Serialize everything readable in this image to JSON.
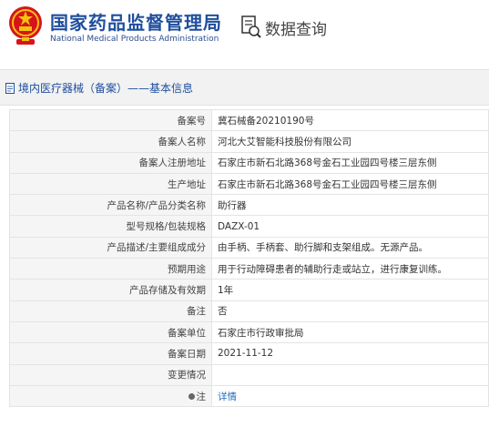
{
  "header": {
    "org_name_cn": "国家药品监督管理局",
    "org_name_en": "National Medical Products Administration",
    "page_title": "数据查询"
  },
  "breadcrumb": {
    "text": "境内医疗器械（备案）——基本信息"
  },
  "table": {
    "rows": [
      {
        "label": "备案号",
        "value": "冀石械备20210190号"
      },
      {
        "label": "备案人名称",
        "value": "河北大艾智能科技股份有限公司"
      },
      {
        "label": "备案人注册地址",
        "value": "石家庄市新石北路368号金石工业园四号楼三层东侧"
      },
      {
        "label": "生产地址",
        "value": "石家庄市新石北路368号金石工业园四号楼三层东侧"
      },
      {
        "label": "产品名称/产品分类名称",
        "value": "助行器"
      },
      {
        "label": "型号规格/包装规格",
        "value": "DAZX-01"
      },
      {
        "label": "产品描述/主要组成成分",
        "value": "由手柄、手柄套、助行脚和支架组成。无源产品。"
      },
      {
        "label": "预期用途",
        "value": "用于行动障碍患者的辅助行走或站立，进行康复训练。"
      },
      {
        "label": "产品存储及有效期",
        "value": "1年"
      },
      {
        "label": "备注",
        "value": "否"
      },
      {
        "label": "备案单位",
        "value": "石家庄市行政审批局"
      },
      {
        "label": "备案日期",
        "value": "2021-11-12"
      },
      {
        "label": "变更情况",
        "value": ""
      },
      {
        "label": "注",
        "value": "详情"
      }
    ]
  },
  "colors": {
    "brand_blue": "#1f4e9e",
    "emblem_red": "#d7141a",
    "link_blue": "#1f6fbf"
  },
  "icons": {
    "emblem": "national-emblem-icon",
    "query": "search-document-icon",
    "breadcrumb": "document-icon",
    "note": "info-dot-icon"
  }
}
